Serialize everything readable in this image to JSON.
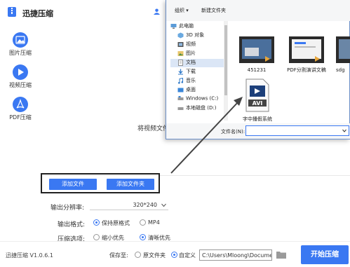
{
  "app": {
    "title": "迅捷压缩",
    "version": "迅捷压缩 V1.0.6.1",
    "brand_color": "#3a78f2"
  },
  "sidebar": {
    "items": [
      {
        "label": "图片压缩",
        "icon": "image-icon"
      },
      {
        "label": "视频压缩",
        "icon": "video-play-icon"
      },
      {
        "label": "PDF压缩",
        "icon": "pdf-icon"
      }
    ]
  },
  "main": {
    "drop_hint": "将视频文件",
    "add_file_label": "添加文件",
    "add_folder_label": "添加文件夹",
    "resolution_label": "输出分辨率:",
    "resolution_value": "320*240",
    "format_label": "输出格式:",
    "format_options": [
      "保持原格式",
      "MP4"
    ],
    "format_selected": 0,
    "compress_label": "压缩选项:",
    "compress_options": [
      "缩小优先",
      "清晰优先"
    ],
    "compress_selected": 1
  },
  "footer": {
    "save_label": "保存至:",
    "save_options": [
      "原文件夹",
      "自定义"
    ],
    "save_selected": 1,
    "path_value": "C:\\Users\\Mloong\\Docume",
    "start_label": "开始压缩"
  },
  "dialog": {
    "organize_label": "组织 ▾",
    "new_folder_label": "新建文件夹",
    "nav_items": [
      {
        "label": "此电脑",
        "icon": "computer-icon"
      },
      {
        "label": "3D 对象",
        "icon": "cube-icon"
      },
      {
        "label": "视频",
        "icon": "video-folder-icon"
      },
      {
        "label": "图片",
        "icon": "picture-folder-icon"
      },
      {
        "label": "文档",
        "icon": "document-folder-icon",
        "selected": true
      },
      {
        "label": "下载",
        "icon": "download-icon"
      },
      {
        "label": "音乐",
        "icon": "music-icon"
      },
      {
        "label": "桌面",
        "icon": "desktop-icon"
      },
      {
        "label": "Windows (C:)",
        "icon": "drive-icon"
      },
      {
        "label": "本地磁盘 (D:)",
        "icon": "drive-icon"
      }
    ],
    "files": [
      {
        "name": "451231",
        "type": "video-thumbnail"
      },
      {
        "name": "PDF分割演讲文稿",
        "type": "video-thumbnail"
      },
      {
        "name": "sdg",
        "type": "video-thumbnail"
      },
      {
        "name": "字中播假系统",
        "type": "avi-file"
      }
    ],
    "avi_badge": "AVI",
    "filename_label": "文件名(N):",
    "filename_value": ""
  }
}
